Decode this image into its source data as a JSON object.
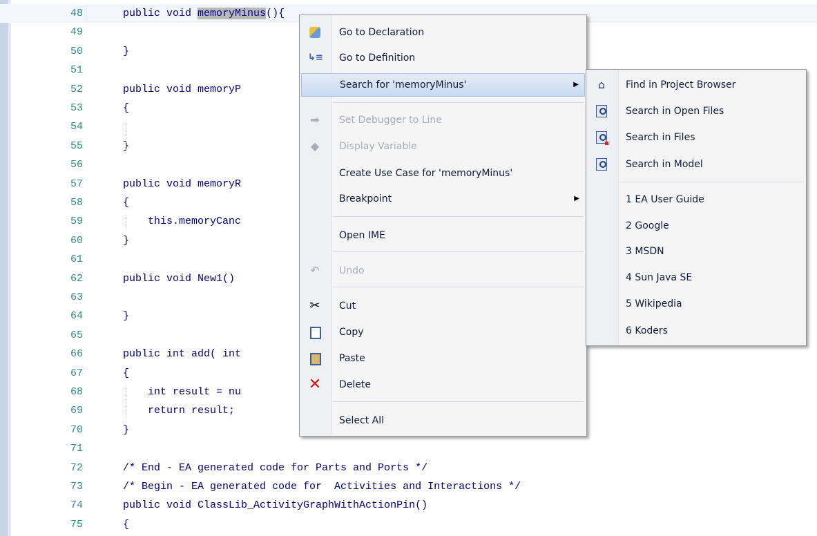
{
  "editor": {
    "lines": [
      {
        "n": "48",
        "code": "public void ",
        "hl": "memoryMinus",
        "rest": "(){"
      },
      {
        "n": "49",
        "code": ""
      },
      {
        "n": "50",
        "code": "}"
      },
      {
        "n": "51",
        "code": ""
      },
      {
        "n": "52",
        "code": "public void memoryP"
      },
      {
        "n": "53",
        "code": "{"
      },
      {
        "n": "54",
        "code": ""
      },
      {
        "n": "55",
        "code": "}"
      },
      {
        "n": "56",
        "code": ""
      },
      {
        "n": "57",
        "code": "public void memoryR"
      },
      {
        "n": "58",
        "code": "{"
      },
      {
        "n": "59",
        "code": "    this.memoryCanc"
      },
      {
        "n": "60",
        "code": "}"
      },
      {
        "n": "61",
        "code": ""
      },
      {
        "n": "62",
        "code": "public void New1()"
      },
      {
        "n": "63",
        "code": ""
      },
      {
        "n": "64",
        "code": "}"
      },
      {
        "n": "65",
        "code": ""
      },
      {
        "n": "66",
        "code": "public int add( int"
      },
      {
        "n": "67",
        "code": "{"
      },
      {
        "n": "68",
        "code": "    int result = nu"
      },
      {
        "n": "69",
        "code": "    return result;"
      },
      {
        "n": "70",
        "code": "}"
      },
      {
        "n": "71",
        "code": ""
      },
      {
        "n": "72",
        "code": "/* End - EA generated code for Parts and Ports */"
      },
      {
        "n": "73",
        "code": "/* Begin - EA generated code for  Activities and Interactions */"
      },
      {
        "n": "74",
        "code": "public void ClassLib_ActivityGraphWithActionPin()"
      },
      {
        "n": "75",
        "code": "{"
      }
    ]
  },
  "context_menu": {
    "go_to_declaration": {
      "label": "Go to Declaration",
      "icon": "declaration-icon"
    },
    "go_to_definition": {
      "label": "Go to Definition",
      "icon": "definition-icon"
    },
    "search_for": {
      "label": "Search for 'memoryMinus'"
    },
    "set_debugger": {
      "label": "Set Debugger to Line",
      "icon": "arrow-right-icon"
    },
    "display_variable": {
      "label": "Display Variable",
      "icon": "variable-icon"
    },
    "create_use_case": {
      "label": "Create Use Case for 'memoryMinus'"
    },
    "breakpoint": {
      "label": "Breakpoint"
    },
    "open_ime": {
      "label": "Open IME"
    },
    "undo": {
      "label": "Undo",
      "icon": "undo-icon"
    },
    "cut": {
      "label": "Cut",
      "icon": "scissors-icon"
    },
    "copy": {
      "label": "Copy",
      "icon": "copy-icon"
    },
    "paste": {
      "label": "Paste",
      "icon": "paste-icon"
    },
    "delete": {
      "label": "Delete",
      "icon": "delete-x-icon"
    },
    "select_all": {
      "label": "Select All"
    }
  },
  "search_submenu": {
    "find_in_project_browser": "Find in Project Browser",
    "search_in_open_files": "Search in Open Files",
    "search_in_files": "Search in Files",
    "search_in_model": "Search in Model",
    "web_searches": [
      "1 EA User Guide",
      "2 Google",
      "3 MSDN",
      "4 Sun Java SE",
      "5 Wikipedia",
      "6 Koders"
    ]
  }
}
